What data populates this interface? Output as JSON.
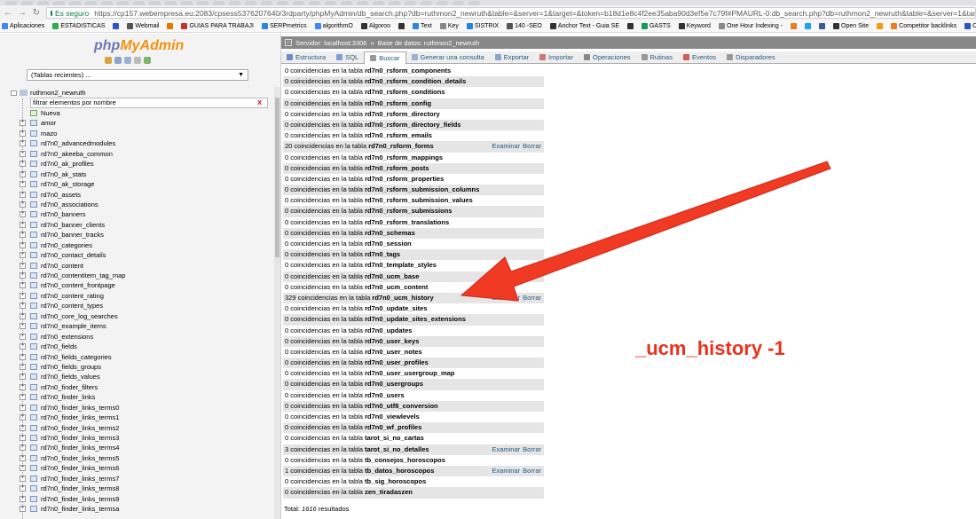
{
  "browser": {
    "secure_label": "Es seguro",
    "url": "https://cp157.webempresa.eu:2083/cpsess5376207640/3rdparty/phpMyAdmin/db_search.php?db=ruthmon2_newruth&table=&server=1&target=&token=b18d1e8c4f2ee35aba90d3ef5e7c79f#PMAURL-0:db_search.php?db=ruthmon2_newruth&table=&server=1&target=&tok",
    "bookmarks": [
      {
        "label": "Aplicaciones",
        "icon": "apps-icon",
        "color": "#4285f4"
      },
      {
        "label": "ESTADISTICAS",
        "icon": "google-icon",
        "color": "#34a853"
      },
      {
        "label": "",
        "icon": "m-icon",
        "color": "#2a56c6"
      },
      {
        "label": "Webmail",
        "icon": "webmail-icon",
        "color": "#555555"
      },
      {
        "label": "",
        "icon": "user-icon",
        "color": "#e07b00"
      },
      {
        "label": "GUIAS PARA TRABAJI",
        "icon": "folder-icon",
        "color": "#c0392b"
      },
      {
        "label": "SERPmetrics",
        "icon": "chart-icon",
        "color": "#2e86de"
      },
      {
        "label": "algorithmO",
        "icon": "google-icon",
        "color": "#4285f4"
      },
      {
        "label": "Algoroo",
        "icon": "kangaroo-icon",
        "color": "#333333"
      },
      {
        "label": "",
        "icon": "flag-icon",
        "color": "#333333"
      },
      {
        "label": "Text",
        "icon": "text-icon",
        "color": "#2e86de"
      },
      {
        "label": "Key",
        "icon": "page-icon",
        "color": "#888888"
      },
      {
        "label": "SISTRIX",
        "icon": "search-icon",
        "color": "#1e88e5"
      },
      {
        "label": "140 -SEO",
        "icon": "list-icon",
        "color": "#555555"
      },
      {
        "label": "Anchor Text - Guia SE",
        "icon": "seo-icon",
        "color": "#333333"
      },
      {
        "label": "",
        "icon": "plus-icon",
        "color": "#333333"
      },
      {
        "label": "GASTS",
        "icon": "sheet-icon",
        "color": "#0f9d58"
      },
      {
        "label": "Keyword",
        "icon": "m-icon",
        "color": "#333333"
      },
      {
        "label": "One Hour Indexing -",
        "icon": "page-icon",
        "color": "#888888"
      },
      {
        "label": "",
        "icon": "pen-icon",
        "color": "#e67e22"
      },
      {
        "label": "",
        "icon": "twitter-icon",
        "color": "#1da1f2"
      },
      {
        "label": "",
        "icon": "facebook-icon",
        "color": "#3b5998"
      },
      {
        "label": "Open Site",
        "icon": "m-icon",
        "color": "#333333"
      },
      {
        "label": "",
        "icon": "bars-icon",
        "color": "#f39c12"
      },
      {
        "label": "Competitor backlinks",
        "icon": "monitor-icon",
        "color": "#e67e22"
      },
      {
        "label": "Co",
        "icon": "square-icon",
        "color": "#2a56c6"
      }
    ]
  },
  "left": {
    "logo_php": "php",
    "logo_my": "MyAdmin",
    "recent": "(Tablas recientes) ...",
    "db_name": "ruthmon2_newruth",
    "filter_placeholder": "filtrar elementos por nombre",
    "filter_clear": "X",
    "nueva": "Nueva",
    "tables": [
      "amor",
      "mazo",
      "rd7n0_advancedmodules",
      "rd7n0_akeeba_common",
      "rd7n0_ak_profiles",
      "rd7n0_ak_stats",
      "rd7n0_ak_storage",
      "rd7n0_assets",
      "rd7n0_associations",
      "rd7n0_banners",
      "rd7n0_banner_clients",
      "rd7n0_banner_tracks",
      "rd7n0_categories",
      "rd7n0_contact_details",
      "rd7n0_content",
      "rd7n0_contentitem_tag_map",
      "rd7n0_content_frontpage",
      "rd7n0_content_rating",
      "rd7n0_content_types",
      "rd7n0_core_log_searches",
      "rd7n0_example_items",
      "rd7n0_extensions",
      "rd7n0_fields",
      "rd7n0_fields_categories",
      "rd7n0_fields_groups",
      "rd7n0_fields_values",
      "rd7n0_finder_filters",
      "rd7n0_finder_links",
      "rd7n0_finder_links_terms0",
      "rd7n0_finder_links_terms1",
      "rd7n0_finder_links_terms2",
      "rd7n0_finder_links_terms3",
      "rd7n0_finder_links_terms4",
      "rd7n0_finder_links_terms5",
      "rd7n0_finder_links_terms6",
      "rd7n0_finder_links_terms7",
      "rd7n0_finder_links_terms8",
      "rd7n0_finder_links_terms9",
      "rd7n0_finder_links_termsa"
    ]
  },
  "main": {
    "server_label": "Servidor: localhost:3306",
    "db_label": "Base de datos: ruthmon2_newruth",
    "tabs": [
      {
        "label": "Estructura",
        "icon": "structure-icon",
        "color": "#6a8fc7"
      },
      {
        "label": "SQL",
        "icon": "sql-icon",
        "color": "#7a9fd0"
      },
      {
        "label": "Buscar",
        "icon": "search-icon",
        "color": "#999999"
      },
      {
        "label": "Generar una consulta",
        "icon": "query-icon",
        "color": "#9bb3d3"
      },
      {
        "label": "Exportar",
        "icon": "export-icon",
        "color": "#8aa6c8"
      },
      {
        "label": "Importar",
        "icon": "import-icon",
        "color": "#c87a7a"
      },
      {
        "label": "Operaciones",
        "icon": "wrench-icon",
        "color": "#888888"
      },
      {
        "label": "Rutinas",
        "icon": "routines-icon",
        "color": "#999999"
      },
      {
        "label": "Eventos",
        "icon": "clock-icon",
        "color": "#d35b5b"
      },
      {
        "label": "Disparadores",
        "icon": "trigger-icon",
        "color": "#999999"
      }
    ],
    "results": [
      {
        "text": "0 coincidencias en la tabla",
        "table": "rd7n0_rsform_components"
      },
      {
        "text": "0 coincidencias en la tabla",
        "table": "rd7n0_rsform_condition_details"
      },
      {
        "text": "0 coincidencias en la tabla",
        "table": "rd7n0_rsform_conditions"
      },
      {
        "text": "0 coincidencias en la tabla",
        "table": "rd7n0_rsform_config"
      },
      {
        "text": "0 coincidencias en la tabla",
        "table": "rd7n0_rsform_directory"
      },
      {
        "text": "0 coincidencias en la tabla",
        "table": "rd7n0_rsform_directory_fields"
      },
      {
        "text": "0 coincidencias en la tabla",
        "table": "rd7n0_rsform_emails"
      },
      {
        "text": "20 coincidencias en la tabla",
        "table": "rd7n0_rsform_forms",
        "examinar": "Examinar",
        "borrar": "Borrar"
      },
      {
        "text": "0 coincidencias en la tabla",
        "table": "rd7n0_rsform_mappings"
      },
      {
        "text": "0 coincidencias en la tabla",
        "table": "rd7n0_rsform_posts"
      },
      {
        "text": "0 coincidencias en la tabla",
        "table": "rd7n0_rsform_properties"
      },
      {
        "text": "0 coincidencias en la tabla",
        "table": "rd7n0_rsform_submission_columns"
      },
      {
        "text": "0 coincidencias en la tabla",
        "table": "rd7n0_rsform_submission_values"
      },
      {
        "text": "0 coincidencias en la tabla",
        "table": "rd7n0_rsform_submissions"
      },
      {
        "text": "0 coincidencias en la tabla",
        "table": "rd7n0_rsform_translations"
      },
      {
        "text": "0 coincidencias en la tabla",
        "table": "rd7n0_schemas"
      },
      {
        "text": "0 coincidencias en la tabla",
        "table": "rd7n0_session"
      },
      {
        "text": "0 coincidencias en la tabla",
        "table": "rd7n0_tags"
      },
      {
        "text": "0 coincidencias en la tabla",
        "table": "rd7n0_template_styles"
      },
      {
        "text": "0 coincidencias en la tabla",
        "table": "rd7n0_ucm_base"
      },
      {
        "text": "0 coincidencias en la tabla",
        "table": "rd7n0_ucm_content"
      },
      {
        "text": "329 coincidencias en la tabla",
        "table": "rd7n0_ucm_history",
        "examinar": "Examinar",
        "borrar": "Borrar"
      },
      {
        "text": "0 coincidencias en la tabla",
        "table": "rd7n0_update_sites"
      },
      {
        "text": "0 coincidencias en la tabla",
        "table": "rd7n0_update_sites_extensions"
      },
      {
        "text": "0 coincidencias en la tabla",
        "table": "rd7n0_updates"
      },
      {
        "text": "0 coincidencias en la tabla",
        "table": "rd7n0_user_keys"
      },
      {
        "text": "0 coincidencias en la tabla",
        "table": "rd7n0_user_notes"
      },
      {
        "text": "0 coincidencias en la tabla",
        "table": "rd7n0_user_profiles"
      },
      {
        "text": "0 coincidencias en la tabla",
        "table": "rd7n0_user_usergroup_map"
      },
      {
        "text": "0 coincidencias en la tabla",
        "table": "rd7n0_usergroups"
      },
      {
        "text": "0 coincidencias en la tabla",
        "table": "rd7n0_users"
      },
      {
        "text": "0 coincidencias en la tabla",
        "table": "rd7n0_utf8_conversion"
      },
      {
        "text": "0 coincidencias en la tabla",
        "table": "rd7n0_viewlevels"
      },
      {
        "text": "0 coincidencias en la tabla",
        "table": "rd7n0_wf_profiles"
      },
      {
        "text": "0 coincidencias en la tabla",
        "table": "tarot_si_no_cartas"
      },
      {
        "text": "3 coincidencias en la tabla",
        "table": "tarot_si_no_detalles",
        "examinar": "Examinar",
        "borrar": "Borrar"
      },
      {
        "text": "0 coincidencias en la tabla",
        "table": "tb_consejos_horoscopos"
      },
      {
        "text": "1 coincidencias en la tabla",
        "table": "tb_datos_horoscopos",
        "examinar": "Examinar",
        "borrar": "Borrar"
      },
      {
        "text": "0 coincidencias en la tabla",
        "table": "tb_sig_horoscopos"
      },
      {
        "text": "0 coincidencias en la tabla",
        "table": "zen_tiradaszen"
      }
    ],
    "total_label": "Total:",
    "total_value": "1616",
    "total_suffix": "resultados"
  },
  "annotation": {
    "text": "_ucm_history -1",
    "color": "#e8321f"
  }
}
